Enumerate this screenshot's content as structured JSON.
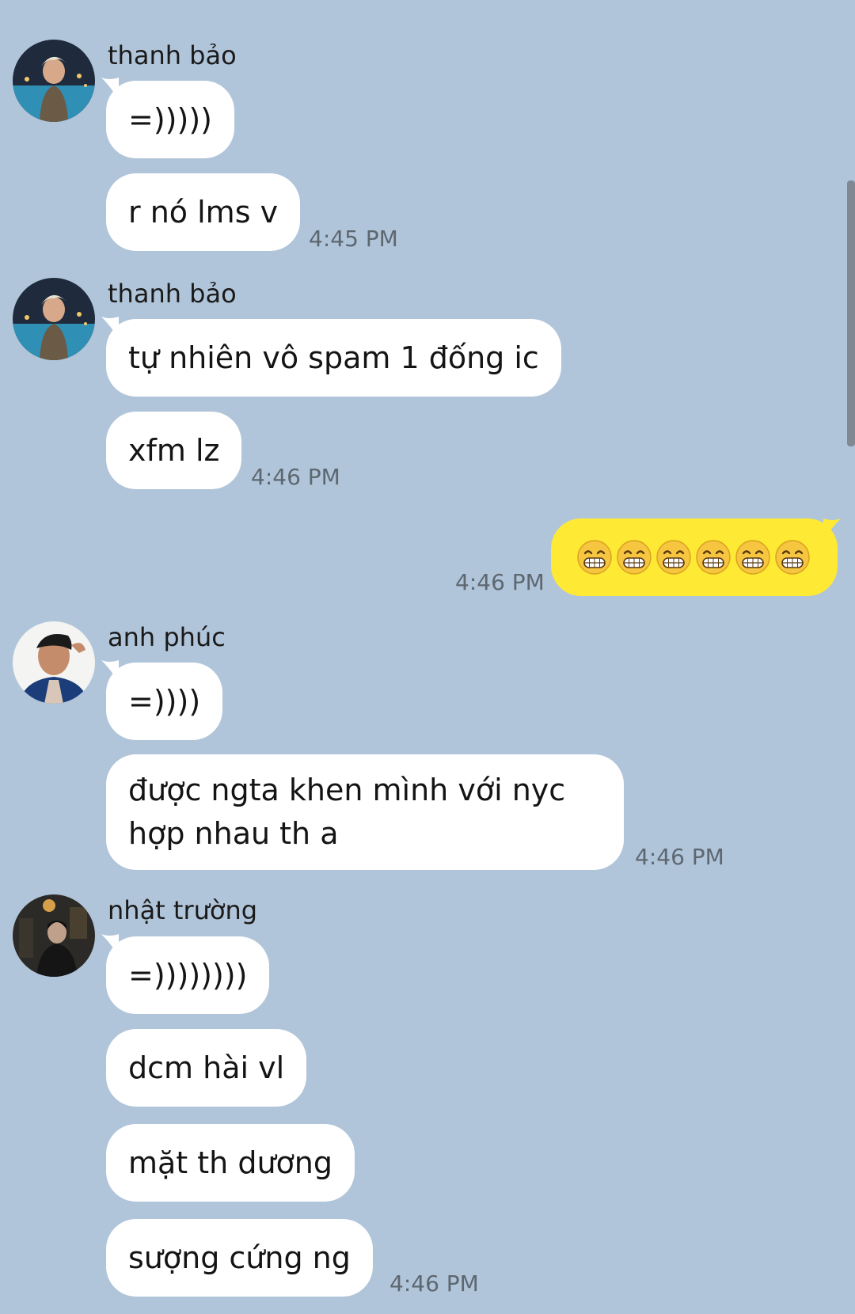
{
  "messages": {
    "group1": {
      "sender": "thanh bảo",
      "msg1": "=)))))",
      "msg2": "r nó lms v",
      "time": "4:45 PM"
    },
    "group2": {
      "sender": "thanh bảo",
      "msg1": "tự nhiên vô spam 1 đống ic",
      "msg2": "xfm lz",
      "time": "4:46 PM"
    },
    "mine": {
      "emoji_count": 6,
      "emoji_name": "grinning-face-with-smiling-eyes",
      "time": "4:46 PM"
    },
    "group3": {
      "sender": "anh phúc",
      "msg1": "=))))",
      "msg2_line1": "được ngta khen mình với nyc",
      "msg2_line2": "hợp nhau th a",
      "time": "4:46 PM"
    },
    "group4": {
      "sender": "nhật trường",
      "msg1": "=))))))))",
      "msg2": "dcm hài vl",
      "msg3": "mặt th dương",
      "msg4": "sượng cứng ng",
      "time": "4:46 PM"
    }
  },
  "colors": {
    "background": "#b1c5da",
    "incoming_bubble": "#ffffff",
    "outgoing_bubble": "#fee934",
    "timestamp": "#5d6770"
  }
}
